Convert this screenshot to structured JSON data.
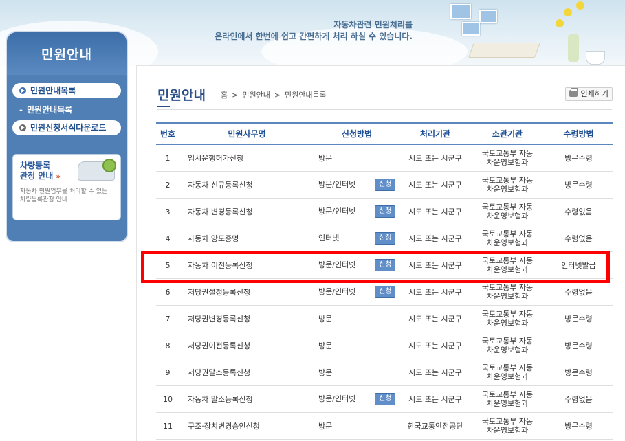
{
  "banner": {
    "line1": "자동차관련 민원처리를",
    "line2": "온라인에서 한번에 쉽고 간편하게 처리 하실 수 있습니다."
  },
  "sidebar": {
    "title": "민원안내",
    "items": [
      {
        "label": "민원안내목록",
        "active": true
      },
      {
        "label": "민원안내목록",
        "sub": true
      },
      {
        "label": "민원신청서식다운로드",
        "active": false
      }
    ],
    "promo": {
      "title_line1": "차량등록",
      "title_line2": "관청 안내",
      "desc_line1": "자동차 민원업무를 처리할 수 있는",
      "desc_line2": "차량등록관청 안내"
    }
  },
  "main": {
    "title": "민원안내",
    "breadcrumb": [
      "홈",
      "민원안내",
      "민원안내목록"
    ],
    "print_label": "인쇄하기",
    "apply_label": "신청",
    "columns": [
      "번호",
      "민원사무명",
      "신청방법",
      "처리기관",
      "소관기관",
      "수령방법"
    ],
    "rows": [
      {
        "no": "1",
        "name": "임시운행허가신청",
        "method": "방문",
        "apply": false,
        "proc": "시도 또는 시군구",
        "org1": "국토교통부 자동",
        "org2": "차운영보험과",
        "receive": "방문수령"
      },
      {
        "no": "2",
        "name": "자동차 신규등록신청",
        "method": "방문/인터넷",
        "apply": true,
        "proc": "시도 또는 시군구",
        "org1": "국토교통부 자동",
        "org2": "차운영보험과",
        "receive": "방문수령"
      },
      {
        "no": "3",
        "name": "자동차 변경등록신청",
        "method": "방문/인터넷",
        "apply": true,
        "proc": "시도 또는 시군구",
        "org1": "국토교통부 자동",
        "org2": "차운영보험과",
        "receive": "수령없음"
      },
      {
        "no": "4",
        "name": "자동차 양도증명",
        "method": "인터넷",
        "apply": true,
        "proc": "시도 또는 시군구",
        "org1": "국토교통부 자동",
        "org2": "차운영보험과",
        "receive": "수령없음"
      },
      {
        "no": "5",
        "name": "자동차 이전등록신청",
        "method": "방문/인터넷",
        "apply": true,
        "proc": "시도 또는 시군구",
        "org1": "국토교통부 자동",
        "org2": "차운영보험과",
        "receive": "인터넷발급"
      },
      {
        "no": "6",
        "name": "저당권설정등록신청",
        "method": "방문/인터넷",
        "apply": true,
        "proc": "시도 또는 시군구",
        "org1": "국토교통부 자동",
        "org2": "차운영보험과",
        "receive": "수령없음"
      },
      {
        "no": "7",
        "name": "저당권변경등록신청",
        "method": "방문",
        "apply": false,
        "proc": "시도 또는 시군구",
        "org1": "국토교통부 자동",
        "org2": "차운영보험과",
        "receive": "방문수령"
      },
      {
        "no": "8",
        "name": "저당권이전등록신청",
        "method": "방문",
        "apply": false,
        "proc": "시도 또는 시군구",
        "org1": "국토교통부 자동",
        "org2": "차운영보험과",
        "receive": "방문수령"
      },
      {
        "no": "9",
        "name": "저당권말소등록신청",
        "method": "방문",
        "apply": false,
        "proc": "시도 또는 시군구",
        "org1": "국토교통부 자동",
        "org2": "차운영보험과",
        "receive": "방문수령"
      },
      {
        "no": "10",
        "name": "자동차 말소등록신청",
        "method": "방문/인터넷",
        "apply": true,
        "proc": "시도 또는 시군구",
        "org1": "국토교통부 자동",
        "org2": "차운영보험과",
        "receive": "수령없음"
      },
      {
        "no": "11",
        "name": "구조·장치변경승인신청",
        "method": "방문",
        "apply": false,
        "proc": "한국교통안전공단",
        "org1": "국토교통부 자동",
        "org2": "차운영보험과",
        "receive": "방문수령"
      }
    ]
  },
  "colors": {
    "accent": "#2a4f86",
    "sidebar_bg": "#4f7fb5",
    "badge_bg": "#5f8ec8",
    "highlight": "#ff0000"
  }
}
